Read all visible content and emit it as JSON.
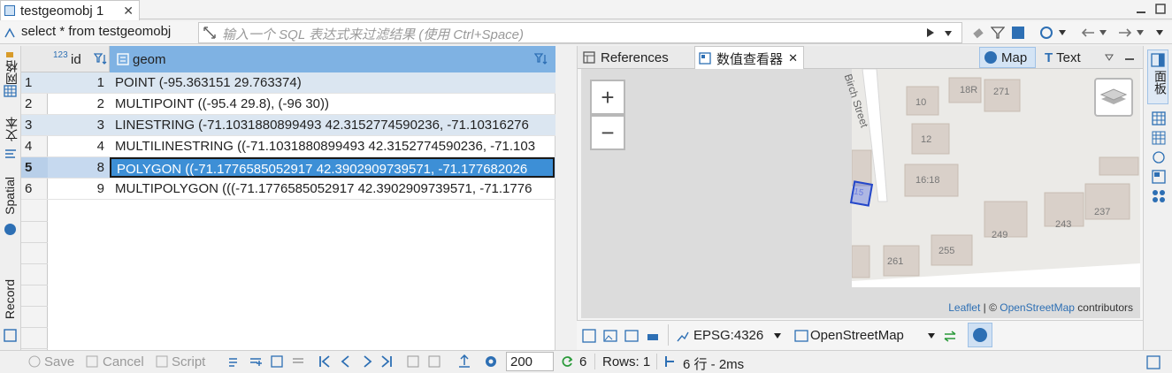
{
  "tab": {
    "title": "testgeomobj 1",
    "close": "✕"
  },
  "filter": {
    "sql": "select * from testgeomobj",
    "placeholder": "输入一个 SQL 表达式来过滤结果 (使用 Ctrl+Space)"
  },
  "left_tabs": [
    "网格",
    "文本",
    "Spatial",
    "Record"
  ],
  "grid": {
    "columns": [
      {
        "name": "id",
        "type": "123"
      },
      {
        "name": "geom"
      }
    ],
    "rows": [
      {
        "num": "1",
        "id": "1",
        "geom": "POINT (-95.363151 29.763374)"
      },
      {
        "num": "2",
        "id": "2",
        "geom": "MULTIPOINT ((-95.4 29.8), (-96 30))"
      },
      {
        "num": "3",
        "id": "3",
        "geom": "LINESTRING (-71.1031880899493 42.3152774590236, -71.10316276"
      },
      {
        "num": "4",
        "id": "4",
        "geom": "MULTILINESTRING ((-71.1031880899493 42.3152774590236, -71.103"
      },
      {
        "num": "5",
        "id": "8",
        "geom": "POLYGON ((-71.1776585052917 42.3902909739571, -71.177682026"
      },
      {
        "num": "6",
        "id": "9",
        "geom": "MULTIPOLYGON (((-71.1776585052917 42.3902909739571, -71.1776"
      }
    ],
    "selected_row": 4
  },
  "panel": {
    "tabs": [
      "References",
      "数值查看器"
    ],
    "close": "✕",
    "view_buttons": [
      "Map",
      "Text"
    ],
    "map_labels": {
      "street": "Birch Street",
      "houses": [
        "10",
        "18R",
        "271",
        "12",
        "16:18",
        "249",
        "243",
        "237",
        "255",
        "261",
        "15"
      ]
    },
    "zoom_in": "+",
    "zoom_out": "−",
    "attribution": {
      "leaflet": "Leaflet",
      "sep": " | © ",
      "osm": "OpenStreetMap",
      "tail": " contributors"
    },
    "crs": "EPSG:4326",
    "basemap": "OpenStreetMap"
  },
  "right_sidebar": {
    "label": "面板"
  },
  "status": {
    "save": "Save",
    "cancel": "Cancel",
    "script": "Script",
    "fetch_size": "200",
    "refresh_count": "6",
    "rows": "Rows: 1",
    "summary": "6 行 - 2ms"
  },
  "colors": {
    "accent": "#3d8fd6",
    "selection": "#3d8fd6",
    "header_blue": "#7fb2e3"
  }
}
